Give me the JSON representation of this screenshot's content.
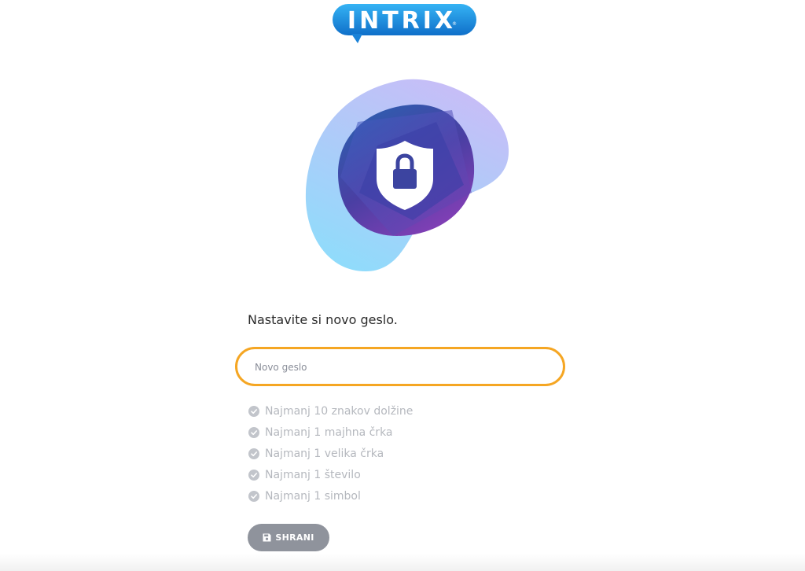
{
  "logo": {
    "text": "intrix",
    "registered": "®"
  },
  "title": "Nastavite si novo geslo.",
  "password_field": {
    "placeholder": "Novo geslo",
    "value": ""
  },
  "rules": [
    {
      "label": "Najmanj 10 znakov dolžine"
    },
    {
      "label": "Najmanj 1 majhna črka"
    },
    {
      "label": "Najmanj 1 velika črka"
    },
    {
      "label": "Najmanj 1 število"
    },
    {
      "label": "Najmanj 1 simbol"
    }
  ],
  "save_button": {
    "label": "SHRANI",
    "icon": "floppy-disk-icon"
  },
  "colors": {
    "focus_border": "#f5a623",
    "button_bg": "#8f939c",
    "rule_text": "#b5b8be",
    "logo_blue": "#1a8fe0"
  }
}
